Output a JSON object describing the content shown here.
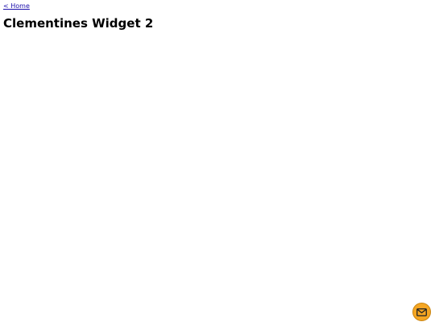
{
  "nav": {
    "home_link_label": "< Home"
  },
  "main": {
    "title": "Clementines Widget 2"
  },
  "contact_button": {
    "icon": "mail-icon",
    "accent_color": "#f5a623"
  },
  "colors": {
    "link": "#1a0dab",
    "background": "#ffffff"
  }
}
